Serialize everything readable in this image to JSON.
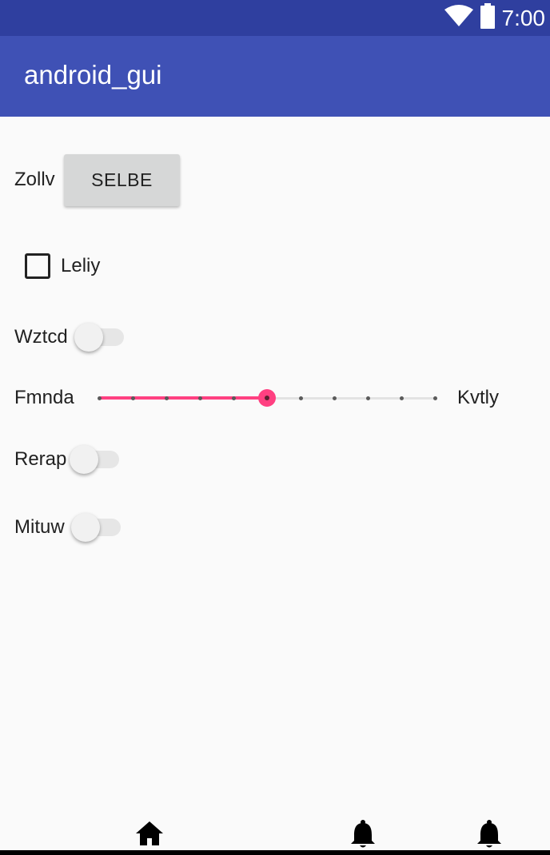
{
  "status_bar": {
    "time": "7:00",
    "wifi_icon": "wifi-icon",
    "battery_icon": "battery-icon"
  },
  "app_bar": {
    "title": "android_gui"
  },
  "content": {
    "button_row": {
      "label": "Zollv",
      "button_label": "SELBE"
    },
    "checkbox": {
      "label": "Leliy",
      "checked": false
    },
    "switch_1": {
      "label": "Wztcd",
      "on": false
    },
    "slider": {
      "left_label": "Fmnda",
      "right_label": "Kvtly",
      "steps": 10,
      "value": 5
    },
    "switch_2": {
      "label": "Rerap",
      "on": false
    },
    "switch_3": {
      "label": "Mituw",
      "on": false
    }
  },
  "bottom_nav": {
    "items": [
      {
        "icon": "home-icon"
      },
      {
        "icon": "bell-icon"
      },
      {
        "icon": "bell-icon"
      }
    ]
  },
  "colors": {
    "status_bar": "#2f3f9f",
    "app_bar": "#3f51b5",
    "accent": "#ff4081"
  }
}
